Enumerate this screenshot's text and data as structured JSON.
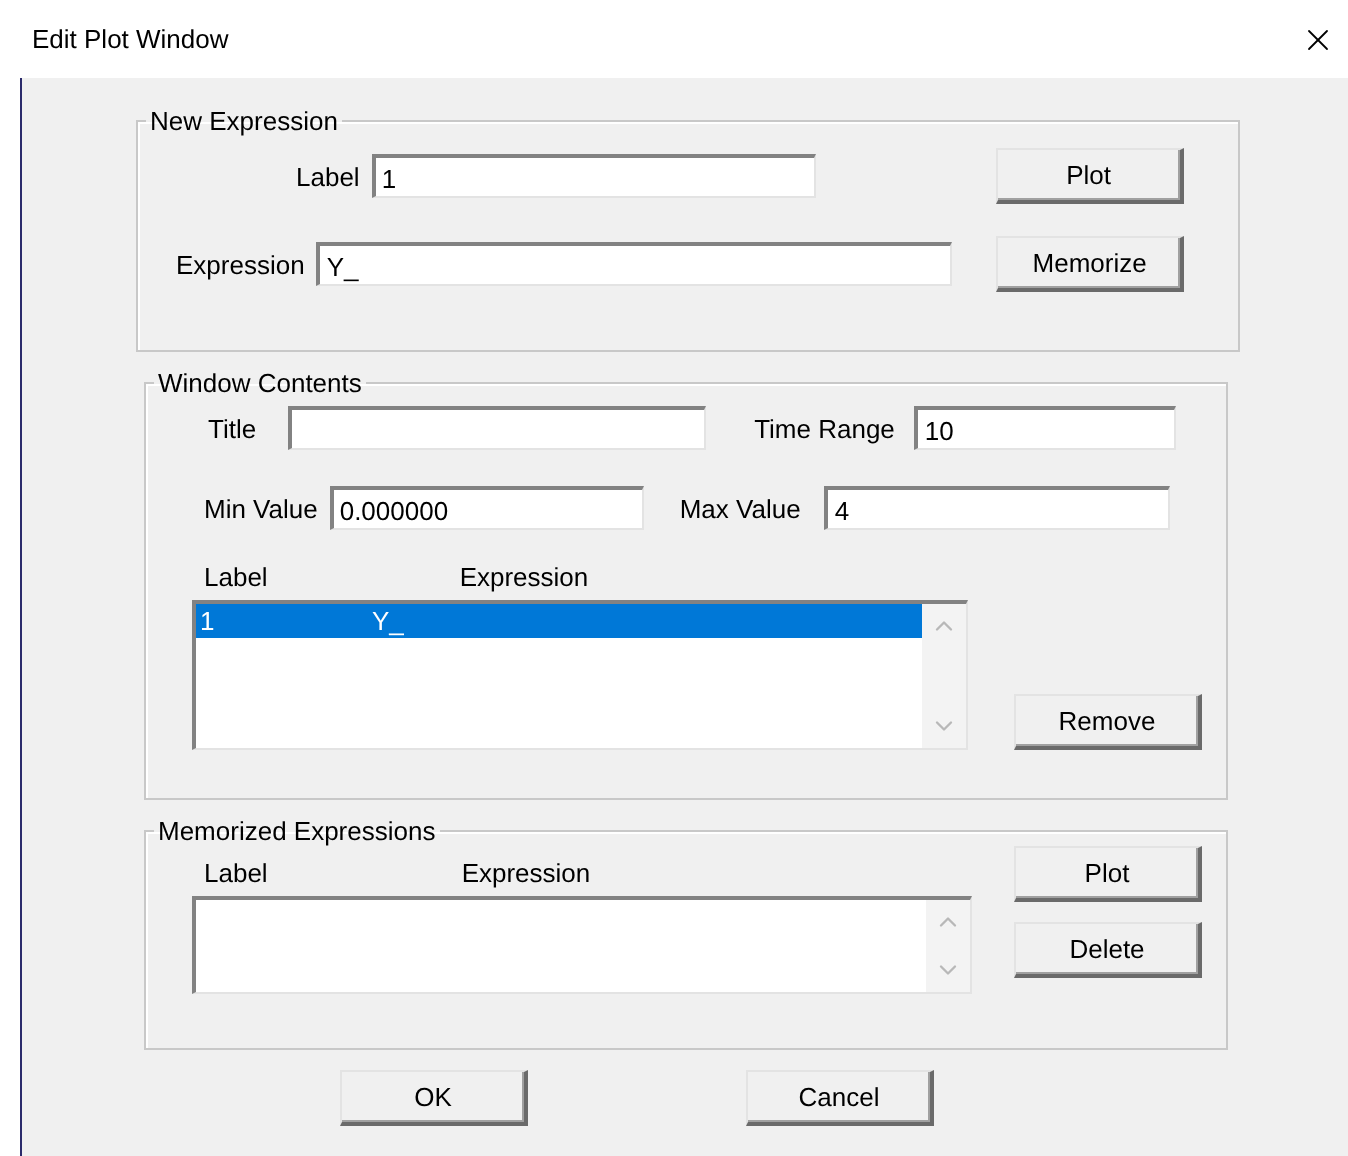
{
  "window": {
    "title": "Edit Plot Window"
  },
  "new_expression": {
    "legend": "New Expression",
    "fields": [
      {
        "label": "Label",
        "value": "1"
      },
      {
        "label": "Expression",
        "value": "Y_"
      }
    ],
    "buttons": [
      "Plot",
      "Memorize"
    ]
  },
  "window_contents": {
    "legend": "Window Contents",
    "fields": [
      {
        "label": "Title"
      },
      {
        "label": "Time Range",
        "value": "10"
      },
      {
        "label": "Min Value",
        "value": "0.000000"
      },
      {
        "label": "Max Value",
        "value": "4"
      }
    ],
    "columns": [
      "Label",
      "Expression"
    ],
    "rows": [
      {
        "label": "1",
        "expression": "Y_",
        "selected": true
      }
    ],
    "button": "Remove"
  },
  "memorized": {
    "legend": "Memorized Expressions",
    "columns": [
      "Label",
      "Expression"
    ],
    "buttons": [
      "Plot",
      "Delete"
    ]
  },
  "footer_buttons": [
    "OK",
    "Cancel"
  ]
}
